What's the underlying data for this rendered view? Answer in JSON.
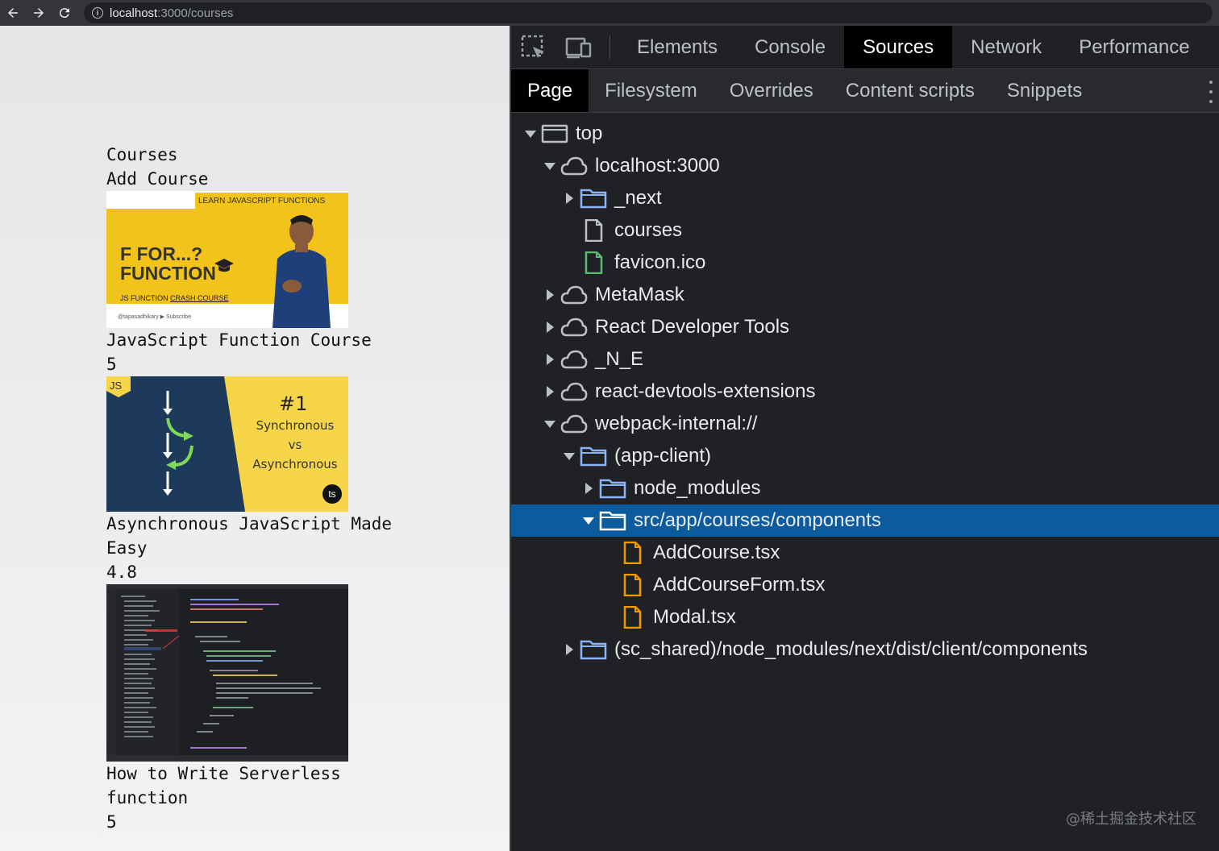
{
  "browser": {
    "url_host": "localhost",
    "url_path": ":3000/courses"
  },
  "page": {
    "heading": "Courses",
    "add_link": "Add Course",
    "courses": [
      {
        "title": "JavaScript Function Course",
        "rating": "5",
        "thumb": {
          "tag": "LEARN JAVASCRIPT FUNCTIONS",
          "line1": "F FOR...?",
          "line2": "FUNCTION",
          "sub_prefix": "JS FUNCTION ",
          "sub_link": "CRASH COURSE",
          "footer": "@tapasadhikary  ▶ Subscribe"
        }
      },
      {
        "title": "Asynchronous JavaScript Made Easy",
        "rating": "4.8",
        "thumb": {
          "badge": "JS",
          "number": "#1",
          "word1": "Synchronous",
          "word2": "vs",
          "word3": "Asynchronous",
          "logo": "ts"
        }
      },
      {
        "title": "How to Write Serverless function",
        "rating": "5"
      }
    ]
  },
  "devtools": {
    "main_tabs": [
      "Elements",
      "Console",
      "Sources",
      "Network",
      "Performance"
    ],
    "sub_tabs": [
      "Page",
      "Filesystem",
      "Overrides",
      "Content scripts",
      "Snippets"
    ],
    "tree": [
      {
        "label": "top"
      },
      {
        "label": "localhost:3000"
      },
      {
        "label": "_next"
      },
      {
        "label": "courses"
      },
      {
        "label": "favicon.ico"
      },
      {
        "label": "MetaMask"
      },
      {
        "label": "React Developer Tools"
      },
      {
        "label": "_N_E"
      },
      {
        "label": "react-devtools-extensions"
      },
      {
        "label": "webpack-internal://"
      },
      {
        "label": "(app-client)"
      },
      {
        "label": "node_modules"
      },
      {
        "label": "src/app/courses/components"
      },
      {
        "label": "AddCourse.tsx"
      },
      {
        "label": "AddCourseForm.tsx"
      },
      {
        "label": "Modal.tsx"
      },
      {
        "label": "(sc_shared)/node_modules/next/dist/client/components"
      }
    ],
    "watermark": "@稀土掘金技术社区"
  },
  "colors": {
    "selected_row": "#0b5b9e",
    "folder_icon": "#8ab4f8",
    "favicon_icon": "#5bb974",
    "tsx_icon": "#f29900"
  }
}
